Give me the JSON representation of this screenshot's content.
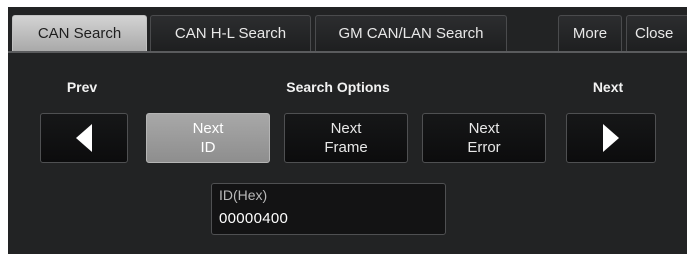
{
  "tabs": [
    {
      "label": "CAN Search",
      "active": true
    },
    {
      "label": "CAN H-L Search",
      "active": false
    },
    {
      "label": "GM CAN/LAN Search",
      "active": false
    }
  ],
  "more_label": "More",
  "close_label": "Close",
  "headers": {
    "prev": "Prev",
    "search_options": "Search Options",
    "next": "Next"
  },
  "buttons": {
    "prev_icon": "left-arrow-icon",
    "next_id": {
      "line1": "Next",
      "line2": "ID",
      "selected": true
    },
    "next_frame": {
      "line1": "Next",
      "line2": "Frame",
      "selected": false
    },
    "next_error": {
      "line1": "Next",
      "line2": "Error",
      "selected": false
    },
    "next_icon": "right-arrow-icon"
  },
  "id_field": {
    "label": "ID(Hex)",
    "value": "00000400"
  },
  "colors": {
    "panel_bg": "#222324",
    "active_tab": "#c4c4c4",
    "selected_button": "#9c9c9c"
  }
}
